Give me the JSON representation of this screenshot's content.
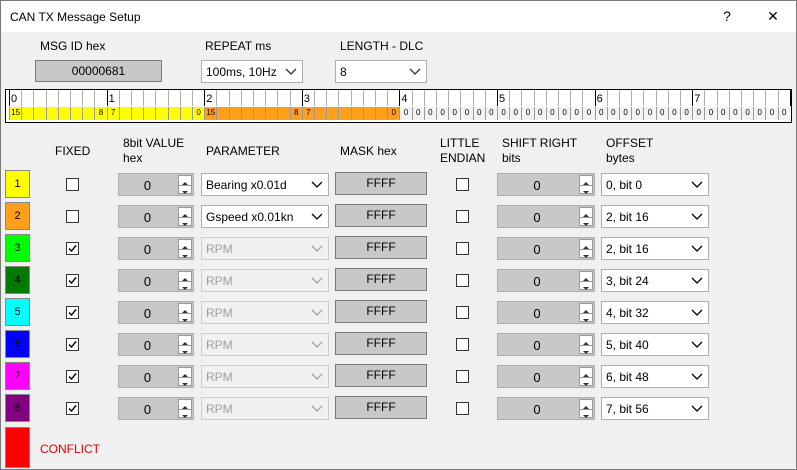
{
  "window": {
    "title": "CAN TX Message Setup",
    "help_glyph": "?",
    "close_glyph": "✕"
  },
  "header": {
    "msg_id_label": "MSG ID hex",
    "msg_id_value": "00000681",
    "repeat_label": "REPEAT ms",
    "repeat_value": "100ms, 10Hz",
    "dlc_label": "LENGTH - DLC",
    "dlc_value": "8"
  },
  "bitbar": {
    "byte_labels": [
      "0",
      "1",
      "2",
      "3",
      "4",
      "5",
      "6",
      "7"
    ],
    "segments": [
      {
        "byte": 0,
        "color": "#ffff00",
        "labels": {
          "0": "15",
          "7": "8",
          "8": "7",
          "15": "0"
        }
      },
      {
        "byte": 1,
        "color": "#ffff00",
        "labels": {}
      },
      {
        "byte": 2,
        "color": "#ff9f1c",
        "labels": {
          "0": "15",
          "7": "8",
          "8": "7",
          "15": "0"
        }
      },
      {
        "byte": 3,
        "color": "#ff9f1c",
        "labels": {}
      }
    ],
    "empty_label": "0"
  },
  "columns": {
    "fixed": "FIXED",
    "value_1": "8bit VALUE",
    "value_2": "hex",
    "parameter": "PARAMETER",
    "mask": "MASK hex",
    "endian_1": "LITTLE",
    "endian_2": "ENDIAN",
    "shift_1": "SHIFT RIGHT",
    "shift_2": "bits",
    "offset_1": "OFFSET",
    "offset_2": "bytes"
  },
  "rows": [
    {
      "num": "1",
      "color": "#ffff00",
      "numcolor": "#000000",
      "fixed": false,
      "value": "0",
      "parameter": "Bearing x0.01d",
      "param_enabled": true,
      "mask": "FFFF",
      "little_endian": false,
      "shift": "0",
      "offset": "0, bit 0"
    },
    {
      "num": "2",
      "color": "#ff9f1c",
      "numcolor": "#000000",
      "fixed": false,
      "value": "0",
      "parameter": "Gspeed x0.01kn",
      "param_enabled": true,
      "mask": "FFFF",
      "little_endian": false,
      "shift": "0",
      "offset": "2, bit 16"
    },
    {
      "num": "3",
      "color": "#00ff00",
      "numcolor": "#000000",
      "fixed": true,
      "value": "0",
      "parameter": "RPM",
      "param_enabled": false,
      "mask": "FFFF",
      "little_endian": false,
      "shift": "0",
      "offset": "2, bit 16"
    },
    {
      "num": "4",
      "color": "#007a00",
      "numcolor": "#000000",
      "fixed": true,
      "value": "0",
      "parameter": "RPM",
      "param_enabled": false,
      "mask": "FFFF",
      "little_endian": false,
      "shift": "0",
      "offset": "3, bit 24"
    },
    {
      "num": "5",
      "color": "#00ffff",
      "numcolor": "#000000",
      "fixed": true,
      "value": "0",
      "parameter": "RPM",
      "param_enabled": false,
      "mask": "FFFF",
      "little_endian": false,
      "shift": "0",
      "offset": "4, bit 32"
    },
    {
      "num": "6",
      "color": "#0000ff",
      "numcolor": "#000000",
      "fixed": true,
      "value": "0",
      "parameter": "RPM",
      "param_enabled": false,
      "mask": "FFFF",
      "little_endian": false,
      "shift": "0",
      "offset": "5, bit 40"
    },
    {
      "num": "7",
      "color": "#ff00ff",
      "numcolor": "#000000",
      "fixed": true,
      "value": "0",
      "parameter": "RPM",
      "param_enabled": false,
      "mask": "FFFF",
      "little_endian": false,
      "shift": "0",
      "offset": "6, bit 48"
    },
    {
      "num": "8",
      "color": "#800080",
      "numcolor": "#000000",
      "fixed": true,
      "value": "0",
      "parameter": "RPM",
      "param_enabled": false,
      "mask": "FFFF",
      "little_endian": false,
      "shift": "0",
      "offset": "7, bit 56"
    }
  ],
  "conflict": {
    "color": "#ff0000",
    "label": "CONFLICT"
  }
}
